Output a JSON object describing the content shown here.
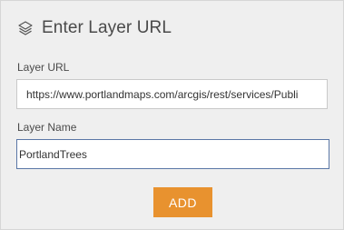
{
  "header": {
    "icon": "layers-icon",
    "title": "Enter Layer URL"
  },
  "form": {
    "url_label": "Layer URL",
    "url_value": "https://www.portlandmaps.com/arcgis/rest/services/Publi",
    "name_label": "Layer Name",
    "name_value": "PortlandTrees"
  },
  "actions": {
    "add_label": "ADD"
  },
  "colors": {
    "panel_bg": "#efefef",
    "accent": "#e8922f",
    "focus_border": "#5a77a6"
  }
}
